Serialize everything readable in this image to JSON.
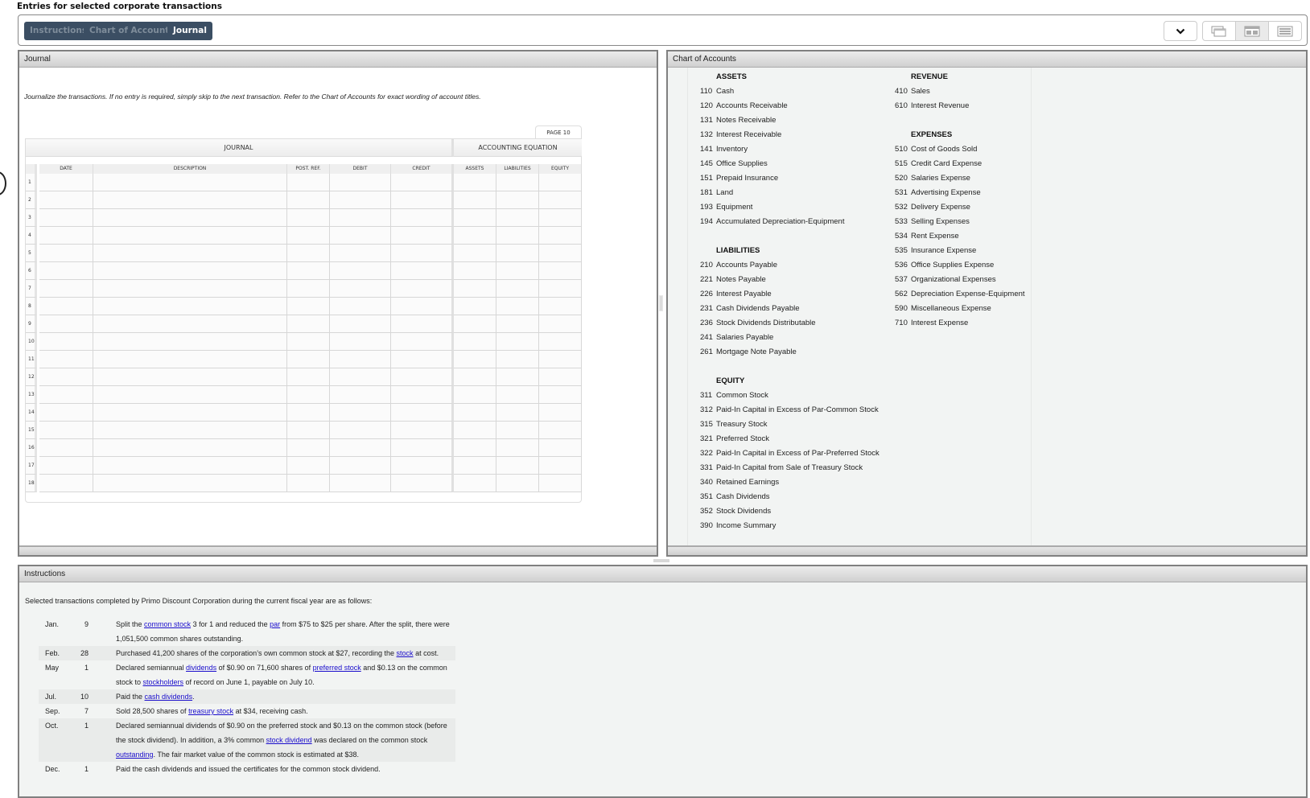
{
  "page_title": "Entries for selected corporate transactions",
  "tabs": [
    {
      "label": "Instructions",
      "active": false
    },
    {
      "label": "Chart of Accounts",
      "active": false
    },
    {
      "label": "Journal",
      "active": true
    }
  ],
  "view_controls": {
    "dropdown_icon": "chevron-down-icon",
    "buttons": [
      "stacked-windows-icon",
      "split-view-icon",
      "list-view-icon"
    ],
    "selected": "split-view-icon"
  },
  "journal_panel": {
    "title": "Journal",
    "instruction": "Journalize the transactions. If no entry is required, simply skip to the next transaction. Refer to the Chart of Accounts for exact wording of account titles.",
    "page_label": "PAGE 10",
    "section_headers": {
      "journal": "JOURNAL",
      "equation": "ACCOUNTING EQUATION"
    },
    "columns": [
      "DATE",
      "DESCRIPTION",
      "POST. REF.",
      "DEBIT",
      "CREDIT",
      "ASSETS",
      "LIABILITIES",
      "EQUITY"
    ],
    "rows": [
      "1",
      "2",
      "3",
      "4",
      "5",
      "6",
      "7",
      "8",
      "9",
      "10",
      "11",
      "12",
      "13",
      "14",
      "15",
      "16",
      "17",
      "18"
    ]
  },
  "chart_of_accounts": {
    "title": "Chart of Accounts",
    "left_groups": [
      {
        "title": "ASSETS",
        "items": [
          {
            "num": "110",
            "name": "Cash"
          },
          {
            "num": "120",
            "name": "Accounts Receivable"
          },
          {
            "num": "131",
            "name": "Notes Receivable"
          },
          {
            "num": "132",
            "name": "Interest Receivable"
          },
          {
            "num": "141",
            "name": "Inventory"
          },
          {
            "num": "145",
            "name": "Office Supplies"
          },
          {
            "num": "151",
            "name": "Prepaid Insurance"
          },
          {
            "num": "181",
            "name": "Land"
          },
          {
            "num": "193",
            "name": "Equipment"
          },
          {
            "num": "194",
            "name": "Accumulated Depreciation-Equipment"
          }
        ]
      },
      {
        "title": "LIABILITIES",
        "items": [
          {
            "num": "210",
            "name": "Accounts Payable"
          },
          {
            "num": "221",
            "name": "Notes Payable"
          },
          {
            "num": "226",
            "name": "Interest Payable"
          },
          {
            "num": "231",
            "name": "Cash Dividends Payable"
          },
          {
            "num": "236",
            "name": "Stock Dividends Distributable"
          },
          {
            "num": "241",
            "name": "Salaries Payable"
          },
          {
            "num": "261",
            "name": "Mortgage Note Payable"
          }
        ]
      },
      {
        "title": "EQUITY",
        "items": [
          {
            "num": "311",
            "name": "Common Stock"
          },
          {
            "num": "312",
            "name": "Paid-In Capital in Excess of Par-Common Stock"
          },
          {
            "num": "315",
            "name": "Treasury Stock"
          },
          {
            "num": "321",
            "name": "Preferred Stock"
          },
          {
            "num": "322",
            "name": "Paid-In Capital in Excess of Par-Preferred Stock"
          },
          {
            "num": "331",
            "name": "Paid-In Capital from Sale of Treasury Stock"
          },
          {
            "num": "340",
            "name": "Retained Earnings"
          },
          {
            "num": "351",
            "name": "Cash Dividends"
          },
          {
            "num": "352",
            "name": "Stock Dividends"
          },
          {
            "num": "390",
            "name": "Income Summary"
          }
        ]
      }
    ],
    "right_groups": [
      {
        "title": "REVENUE",
        "items": [
          {
            "num": "410",
            "name": "Sales"
          },
          {
            "num": "610",
            "name": "Interest Revenue"
          }
        ]
      },
      {
        "title": "EXPENSES",
        "items": [
          {
            "num": "510",
            "name": "Cost of Goods Sold"
          },
          {
            "num": "515",
            "name": "Credit Card Expense"
          },
          {
            "num": "520",
            "name": "Salaries Expense"
          },
          {
            "num": "531",
            "name": "Advertising Expense"
          },
          {
            "num": "532",
            "name": "Delivery Expense"
          },
          {
            "num": "533",
            "name": "Selling Expenses"
          },
          {
            "num": "534",
            "name": "Rent Expense"
          },
          {
            "num": "535",
            "name": "Insurance Expense"
          },
          {
            "num": "536",
            "name": "Office Supplies Expense"
          },
          {
            "num": "537",
            "name": "Organizational Expenses"
          },
          {
            "num": "562",
            "name": "Depreciation Expense-Equipment"
          },
          {
            "num": "590",
            "name": "Miscellaneous Expense"
          },
          {
            "num": "710",
            "name": "Interest Expense"
          }
        ]
      }
    ]
  },
  "instructions_panel": {
    "title": "Instructions",
    "intro": "Selected transactions completed by Primo Discount Corporation during the current fiscal year are as follows:",
    "transactions": [
      {
        "month": "Jan.",
        "day": "9",
        "shaded": false,
        "parts": [
          {
            "text": "Split the "
          },
          {
            "link": "common stock"
          },
          {
            "text": " 3 for 1 and reduced the "
          },
          {
            "link": "par"
          },
          {
            "text": " from $75 to $25 per share. After the split, there were 1,051,500 common shares outstanding."
          }
        ]
      },
      {
        "month": "Feb.",
        "day": "28",
        "shaded": true,
        "parts": [
          {
            "text": "Purchased 41,200 shares of the corporation’s own common stock at $27, recording the "
          },
          {
            "link": "stock"
          },
          {
            "text": " at cost."
          }
        ]
      },
      {
        "month": "May",
        "day": "1",
        "shaded": false,
        "parts": [
          {
            "text": "Declared semiannual "
          },
          {
            "link": "dividends"
          },
          {
            "text": " of $0.90 on 71,600 shares of "
          },
          {
            "link": "preferred stock"
          },
          {
            "text": " and $0.13 on the common stock to "
          },
          {
            "link": "stockholders"
          },
          {
            "text": " of record on June 1, payable on July 10."
          }
        ]
      },
      {
        "month": "Jul.",
        "day": "10",
        "shaded": true,
        "parts": [
          {
            "text": "Paid the "
          },
          {
            "link": "cash dividends"
          },
          {
            "text": "."
          }
        ]
      },
      {
        "month": "Sep.",
        "day": "7",
        "shaded": false,
        "parts": [
          {
            "text": "Sold 28,500 shares of "
          },
          {
            "link": "treasury stock"
          },
          {
            "text": " at $34, receiving cash."
          }
        ]
      },
      {
        "month": "Oct.",
        "day": "1",
        "shaded": true,
        "parts": [
          {
            "text": "Declared semiannual dividends of $0.90 on the preferred stock and $0.13 on the common stock (before the stock dividend). In addition, a 3% common "
          },
          {
            "link": "stock dividend"
          },
          {
            "text": " was declared on the common stock "
          },
          {
            "link": "outstanding"
          },
          {
            "text": ". The fair market value of the common stock is estimated at $38."
          }
        ]
      },
      {
        "month": "Dec.",
        "day": "1",
        "shaded": false,
        "parts": [
          {
            "text": "Paid the cash dividends and issued the certificates for the common stock dividend."
          }
        ]
      }
    ]
  }
}
